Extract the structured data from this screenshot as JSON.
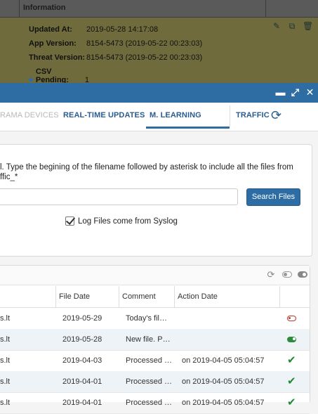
{
  "background_panel": {
    "title": "Information",
    "rows": [
      {
        "label": "Updated At:",
        "value": "2019-05-28 14:17:08"
      },
      {
        "label": "App Version:",
        "value": "8154-5473 (2019-05-22 00:23:03)"
      },
      {
        "label": "Threat Version:",
        "value": "8154-5473 (2019-05-22 00:23:03)"
      },
      {
        "label": "CSV Pending:",
        "value": "1"
      }
    ],
    "icons": [
      "edit-icon",
      "open-icon",
      "trash-icon"
    ]
  },
  "window_controls": [
    "minimize-icon",
    "maximize-icon",
    "close-icon"
  ],
  "tabs": [
    {
      "label": "RAMA DEVICES",
      "state": "dim"
    },
    {
      "label": "REAL-TIME UPDATES",
      "state": "normal"
    },
    {
      "label": "M. LEARNING",
      "state": "active"
    },
    {
      "label": "TRAFFIC",
      "state": "normal"
    }
  ],
  "search": {
    "hint_line1": "l. Type the begining of the filename followed by asterisk to include all the files from",
    "hint_line2": "ffic_*",
    "input_value": "",
    "button_label": "Search Files",
    "syslog_label": "Log Files come from Syslog",
    "syslog_checked": true
  },
  "table": {
    "columns": [
      "File Date",
      "Comment",
      "Action Date"
    ],
    "rows": [
      {
        "name": "s.lt",
        "file_date": "2019-05-29",
        "comment": "Today's fil…",
        "action_date": "",
        "status": "toggle-off"
      },
      {
        "name": "s.lt",
        "file_date": "2019-05-28",
        "comment": "New file. P…",
        "action_date": "",
        "status": "toggle-on"
      },
      {
        "name": "s.lt",
        "file_date": "2019-04-03",
        "comment": "Processed …",
        "action_date": "on 2019-04-05 05:04:57",
        "status": "check"
      },
      {
        "name": "s.lt",
        "file_date": "2019-04-01",
        "comment": "Processed …",
        "action_date": "on 2019-04-05 05:04:57",
        "status": "check"
      },
      {
        "name": "s.lt",
        "file_date": "2019-04-01",
        "comment": "Processed …",
        "action_date": "on 2019-04-05 05:04:57",
        "status": "check"
      }
    ]
  },
  "colors": {
    "accent": "#2e6da4",
    "success": "#1e8a35",
    "danger": "#c0392b"
  }
}
